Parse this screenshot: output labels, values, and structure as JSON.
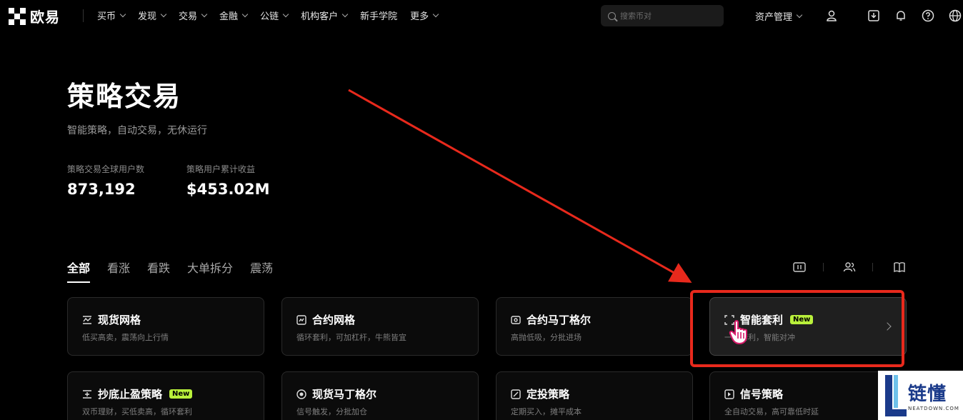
{
  "brand": {
    "name": "欧易"
  },
  "nav": {
    "items": [
      {
        "label": "买币",
        "dropdown": true
      },
      {
        "label": "发现",
        "dropdown": true
      },
      {
        "label": "交易",
        "dropdown": true
      },
      {
        "label": "金融",
        "dropdown": true
      },
      {
        "label": "公链",
        "dropdown": true
      },
      {
        "label": "机构客户",
        "dropdown": true
      },
      {
        "label": "新手学院",
        "dropdown": false
      },
      {
        "label": "更多",
        "dropdown": true
      }
    ],
    "search_placeholder": "搜索币对",
    "asset_menu": "资产管理"
  },
  "hero": {
    "title": "策略交易",
    "subtitle": "智能策略，自动交易，无休运行",
    "stats": [
      {
        "label": "策略交易全球用户数",
        "value": "873,192"
      },
      {
        "label": "策略用户累计收益",
        "value": "$453.02M"
      }
    ]
  },
  "tabs": [
    "全部",
    "看涨",
    "看跌",
    "大单拆分",
    "震荡"
  ],
  "cards": [
    {
      "title": "现货网格",
      "desc": "低买高卖，震荡向上行情",
      "badge": "",
      "icon": "grid-icon"
    },
    {
      "title": "合约网格",
      "desc": "循环套利，可加杠杆，牛熊皆宜",
      "badge": "",
      "icon": "contract-grid-icon"
    },
    {
      "title": "合约马丁格尔",
      "desc": "高抛低吸，分批进场",
      "badge": "",
      "icon": "martingale-icon"
    },
    {
      "title": "智能套利",
      "desc": "一键套利，智能对冲",
      "badge": "New",
      "icon": "arbitrage-icon"
    },
    {
      "title": "抄底止盈策略",
      "desc": "双币理财，买低卖高，循环套利",
      "badge": "New",
      "icon": "dip-buy-icon"
    },
    {
      "title": "现货马丁格尔",
      "desc": "信号触发，分批加仓",
      "badge": "",
      "icon": "spot-martingale-icon"
    },
    {
      "title": "定投策略",
      "desc": "定期买入，摊平成本",
      "badge": "",
      "icon": "recurring-buy-icon"
    },
    {
      "title": "信号策略",
      "desc": "全自动交易，高可靠低时延",
      "badge": "",
      "icon": "signal-icon"
    }
  ],
  "watermark": {
    "cn": "链懂",
    "en": "NEATDOWN.COM"
  },
  "colors": {
    "badge": "#b9f03b",
    "annotation": "#e8291c",
    "watermark": "#1a3a8a"
  }
}
